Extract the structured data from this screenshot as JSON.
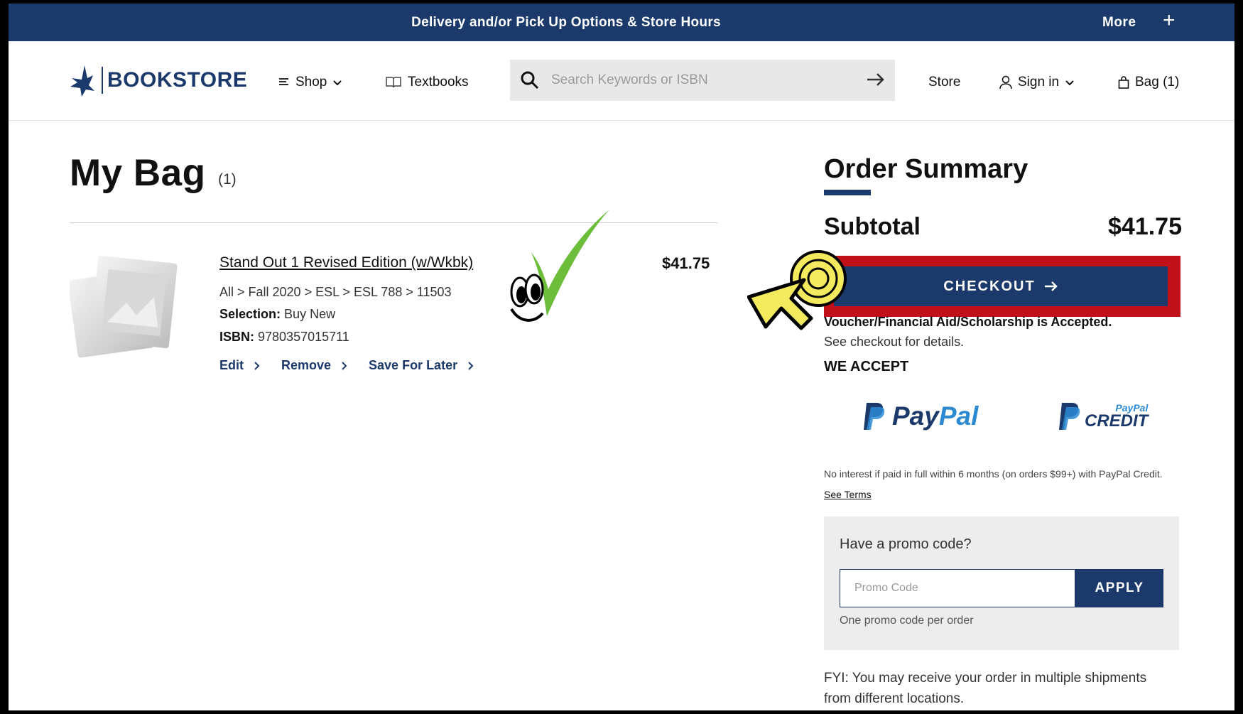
{
  "banner": {
    "text": "Delivery and/or Pick Up Options & Store Hours",
    "more": "More",
    "plus_icon": "plus-icon"
  },
  "header": {
    "logo_text": "BOOKSTORE",
    "shop": "Shop",
    "textbooks": "Textbooks",
    "search_placeholder": "Search Keywords or ISBN",
    "store": "Store",
    "sign_in": "Sign in",
    "bag": "Bag (1)"
  },
  "bag": {
    "title": "My Bag",
    "count": "(1)",
    "item": {
      "title": "Stand Out 1 Revised Edition (w/Wkbk)",
      "price": "$41.75",
      "path": "All > Fall 2020 > ESL > ESL 788 > 11503",
      "selection_label": "Selection:",
      "selection_value": "Buy New",
      "isbn_label": "ISBN:",
      "isbn_value": "9780357015711"
    },
    "actions": {
      "edit": "Edit",
      "remove": "Remove",
      "save": "Save For Later"
    }
  },
  "summary": {
    "title": "Order Summary",
    "subtotal_label": "Subtotal",
    "subtotal_value": "$41.75",
    "checkout": "CHECKOUT",
    "voucher": "Voucher/Financial Aid/Scholarship is Accepted.",
    "see_checkout": "See checkout for details.",
    "we_accept": "WE ACCEPT",
    "paypal_a": "Pay",
    "paypal_b": "Pal",
    "ppc_top": "PayPal",
    "ppc_bottom": "CREDIT",
    "no_interest": "No interest if paid in full within 6 months (on orders $99+) with PayPal Credit.",
    "see_terms": "See Terms",
    "promo_question": "Have a promo code?",
    "promo_placeholder": "Promo Code",
    "apply": "APPLY",
    "promo_note": "One promo code per order",
    "fyi": "FYI: You may receive your order in multiple shipments from different locations."
  },
  "colors": {
    "brand_navy": "#1b3a6b",
    "highlight_red": "#c0101a",
    "check_green": "#6bbd3a",
    "cursor_yellow": "#f3ea5d"
  }
}
